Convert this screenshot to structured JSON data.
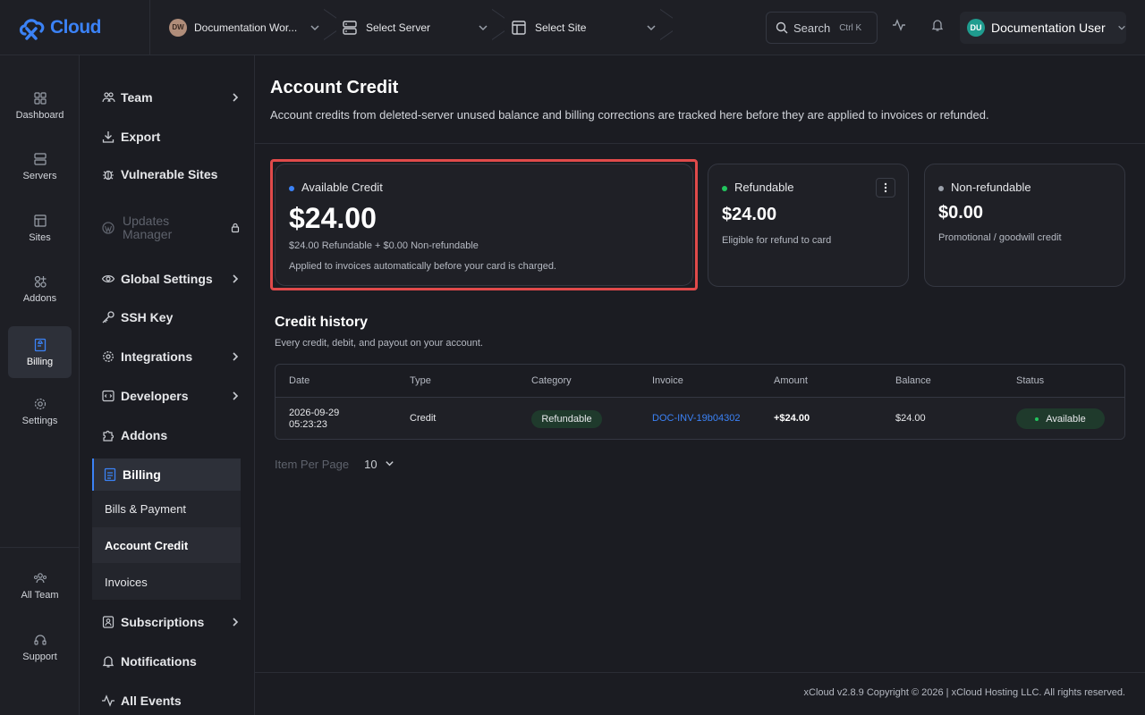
{
  "topbar": {
    "brand": "Cloud",
    "workspace": {
      "initials": "DW",
      "label": "Documentation Wor..."
    },
    "server": {
      "label": "Select Server"
    },
    "site": {
      "label": "Select Site"
    },
    "search": {
      "label": "Search",
      "shortcut": "Ctrl K"
    },
    "user": {
      "initials": "DU",
      "name": "Documentation User"
    }
  },
  "rail": {
    "items": [
      {
        "label": "Dashboard",
        "icon": "dashboard-icon"
      },
      {
        "label": "Servers",
        "icon": "server-icon"
      },
      {
        "label": "Sites",
        "icon": "browser-icon"
      },
      {
        "label": "Addons",
        "icon": "addons-icon"
      },
      {
        "label": "Billing",
        "icon": "receipt-icon",
        "active": true
      },
      {
        "label": "Settings",
        "icon": "gear-icon"
      }
    ],
    "bottom": [
      {
        "label": "All Team",
        "icon": "team-icon"
      },
      {
        "label": "Support",
        "icon": "headset-icon"
      }
    ]
  },
  "sidebar": {
    "items": [
      {
        "label": "Team"
      },
      {
        "label": "Export"
      },
      {
        "label": "Vulnerable Sites"
      },
      {
        "label": "Updates Manager",
        "line1": "Updates",
        "line2": "Manager"
      },
      {
        "label": "Global Settings"
      },
      {
        "label": "SSH Key"
      },
      {
        "label": "Integrations"
      },
      {
        "label": "Developers"
      },
      {
        "label": "Addons"
      }
    ],
    "billing": {
      "label": "Billing",
      "children": [
        "Bills & Payment",
        "Account Credit",
        "Invoices"
      ]
    },
    "after": [
      {
        "label": "Subscriptions"
      },
      {
        "label": "Notifications"
      },
      {
        "label": "All Events"
      }
    ]
  },
  "page": {
    "title": "Account Credit",
    "description": "Account credits from deleted-server unused balance and billing corrections are tracked here before they are applied to invoices or refunded."
  },
  "cards": {
    "available": {
      "label": "Available Credit",
      "amount": "$24.00",
      "breakdown": "$24.00 Refundable + $0.00 Non-refundable",
      "note": "Applied to invoices automatically before your card is charged.",
      "dot_color": "#3b82f6"
    },
    "refundable": {
      "label": "Refundable",
      "amount": "$24.00",
      "note": "Eligible for refund to card",
      "dot_color": "#22c55e"
    },
    "nonrefundable": {
      "label": "Non-refundable",
      "amount": "$0.00",
      "note": "Promotional / goodwill credit",
      "dot_color": "#9aa0aa"
    }
  },
  "history": {
    "title": "Credit history",
    "subtitle": "Every credit, debit, and payout on your account.",
    "columns": [
      "Date",
      "Type",
      "Category",
      "Invoice",
      "Amount",
      "Balance",
      "Status"
    ],
    "rows": [
      {
        "date_line1": "2026-09-29",
        "date_line2": "05:23:23",
        "type": "Credit",
        "category": "Refundable",
        "invoice": "DOC-INV-19b04302",
        "amount": "+$24.00",
        "balance": "$24.00",
        "status": "Available"
      }
    ],
    "per_page_label": "Item Per Page",
    "per_page_value": "10"
  },
  "footer": {
    "text": "xCloud v2.8.9 Copyright © 2026 | xCloud Hosting LLC. All rights reserved."
  },
  "colors": {
    "accent": "#3b82f6",
    "highlight": "#e04a4a",
    "status_green": "#22c55e"
  }
}
